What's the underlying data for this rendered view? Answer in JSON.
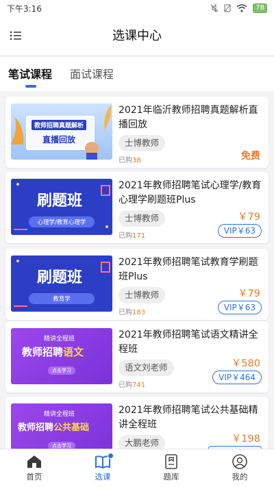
{
  "status_bar": {
    "time": "下午3:16",
    "battery": "78"
  },
  "header": {
    "title": "选课中心",
    "menu_icon": "list-menu-icon"
  },
  "tabs": [
    {
      "label": "笔试课程",
      "active": true
    },
    {
      "label": "面试课程",
      "active": false
    }
  ],
  "courses": [
    {
      "title": "2021年临沂教师招聘真题解析直播回放",
      "teacher": "士博教师",
      "sold_label": "已购",
      "sold_count": "38",
      "price": "免费",
      "vip_price": "",
      "banner": {
        "line1": "教师招聘真题解析",
        "line2": "直播回放"
      }
    },
    {
      "title": "2021年教师招聘笔试心理学/教育心理学刷题班Plus",
      "teacher": "士博教师",
      "sold_label": "已购",
      "sold_count": "171",
      "price": "￥79",
      "vip_price": "VIP￥63",
      "banner": {
        "headline": "刷题班",
        "sub": "心理学/教育心理学"
      }
    },
    {
      "title": "2021年教师招聘笔试教育学刷题班Plus",
      "teacher": "士博教师",
      "sold_label": "已购",
      "sold_count": "183",
      "price": "￥79",
      "vip_price": "VIP￥63",
      "banner": {
        "headline": "刷题班",
        "sub": "教育学"
      }
    },
    {
      "title": "2021年教师招聘笔试语文精讲全程班",
      "teacher": "语文刘老师",
      "sold_label": "已购",
      "sold_count": "741",
      "price": "￥580",
      "vip_price": "VIP￥464",
      "banner": {
        "top": "精讲全程班",
        "main": "教师招聘",
        "accent": "语文",
        "btn": "点击学习"
      }
    },
    {
      "title": "2021年教师招聘笔试公共基础精讲全程班",
      "teacher": "大鹏老师",
      "sold_label": "",
      "sold_count": "",
      "price": "￥198",
      "vip_price": "",
      "banner": {
        "top": "精讲全程班",
        "main": "教师招聘",
        "accent": "公共基础",
        "btn": "点击学习"
      }
    }
  ],
  "bottom_nav": [
    {
      "label": "首页",
      "icon": "home-icon",
      "active": false
    },
    {
      "label": "选课",
      "icon": "book-icon",
      "active": true
    },
    {
      "label": "题库",
      "icon": "question-bank-icon",
      "active": false
    },
    {
      "label": "我的",
      "icon": "profile-icon",
      "active": false
    }
  ],
  "colors": {
    "accent": "#2f6fd9",
    "price": "#ea7a25",
    "banner_blue": "#2c3fc4",
    "banner_purple": "#8a3fe0"
  }
}
